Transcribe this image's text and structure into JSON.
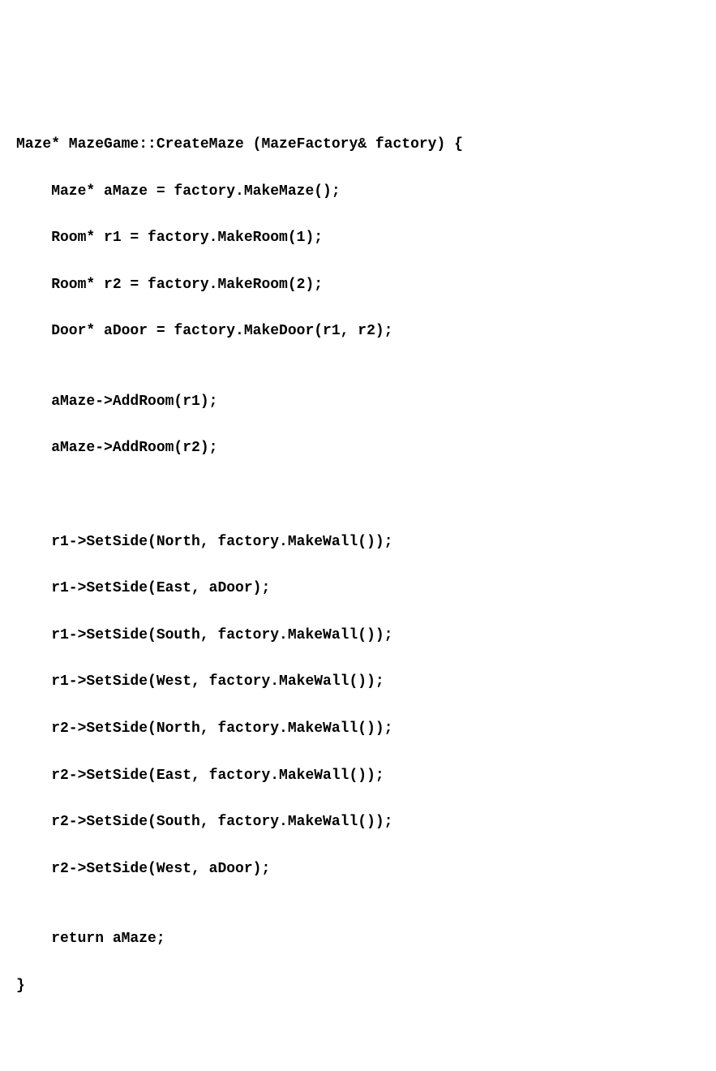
{
  "code": {
    "lines": [
      "Maze* MazeGame::CreateMaze (MazeFactory& factory) {",
      "    Maze* aMaze = factory.MakeMaze();",
      "    Room* r1 = factory.MakeRoom(1);",
      "    Room* r2 = factory.MakeRoom(2);",
      "    Door* aDoor = factory.MakeDoor(r1, r2);",
      "",
      "    aMaze->AddRoom(r1);",
      "    aMaze->AddRoom(r2);",
      "",
      "",
      "    r1->SetSide(North, factory.MakeWall());",
      "    r1->SetSide(East, aDoor);",
      "    r1->SetSide(South, factory.MakeWall());",
      "    r1->SetSide(West, factory.MakeWall());",
      "    r2->SetSide(North, factory.MakeWall());",
      "    r2->SetSide(East, factory.MakeWall());",
      "    r2->SetSide(South, factory.MakeWall());",
      "    r2->SetSide(West, aDoor);",
      "",
      "    return aMaze;",
      "}"
    ]
  }
}
